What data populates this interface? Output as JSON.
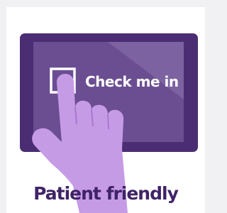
{
  "tile": {
    "button_label": "Check me in",
    "caption": "Patient friendly",
    "icons": {
      "tablet": "tablet-icon",
      "checkbox": "checkbox-icon",
      "hand": "pointing-hand-icon"
    },
    "colors": {
      "background": "#f1f0f2",
      "card": "#ffffff",
      "tablet_frame": "#4a2d72",
      "tablet_screen": "#6b4e91",
      "screen_glare": "#7c62a0",
      "hand": "#c69be6",
      "hand_outline": "#8b5fba",
      "caption": "#3f2366"
    }
  }
}
